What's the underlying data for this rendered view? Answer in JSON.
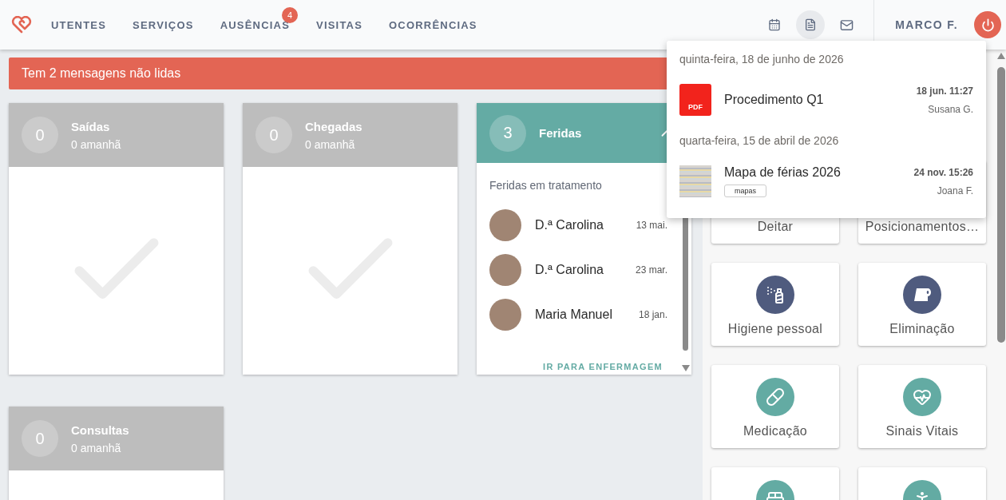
{
  "header": {
    "nav": [
      {
        "label": "UTENTES"
      },
      {
        "label": "SERVIÇOS"
      },
      {
        "label": "AUSÊNCIAS",
        "badge": "4"
      },
      {
        "label": "VISITAS"
      },
      {
        "label": "OCORRÊNCIAS"
      }
    ],
    "tools": [
      {
        "kind": "calendar",
        "selected": false
      },
      {
        "kind": "document",
        "selected": true
      },
      {
        "kind": "mail",
        "selected": false
      }
    ],
    "user": "MARCO F."
  },
  "alert": {
    "text": "Tem 2 mensagens não lidas"
  },
  "summary_cards": [
    {
      "kind": "empty",
      "count": "0",
      "title": "Saídas",
      "subtitle": "0 amanhã"
    },
    {
      "kind": "empty",
      "count": "0",
      "title": "Chegadas",
      "subtitle": "0 amanhã"
    },
    {
      "kind": "list",
      "count": "3",
      "title": "Feridas",
      "heading": "Feridas em tratamento",
      "rows": [
        {
          "name": "D.ª Carolina",
          "date": "13 mai."
        },
        {
          "name": "D.ª Carolina",
          "date": "23 mar."
        },
        {
          "name": "Maria Manuel",
          "date": "18 jan."
        }
      ],
      "link": "IR PARA ENFERMAGEM"
    },
    {
      "kind": "empty",
      "count": "0",
      "title": "Consultas",
      "subtitle": "0 amanhã"
    }
  ],
  "care_tiles": [
    {
      "label": "Deitar"
    },
    {
      "label": "Posicionamentos…"
    },
    {
      "label": "Higiene pessoal",
      "kind": "hygiene",
      "color": "#4f5b7e"
    },
    {
      "label": "Eliminação",
      "kind": "roll",
      "color": "#4f5b7e"
    },
    {
      "label": "Medicação",
      "kind": "pills",
      "color": "#63aba3"
    },
    {
      "label": "Sinais Vitais",
      "kind": "heart",
      "color": "#63aba3"
    },
    {
      "kind": "bed",
      "color": "#63aba3"
    },
    {
      "kind": "person",
      "color": "#63aba3"
    }
  ],
  "documents_menu": {
    "groups": [
      {
        "date": "quinta-feira, 18 de junho de 2026",
        "items": [
          {
            "kind": "pdf",
            "icon_label": "PDF",
            "name": "Procedimento Q1",
            "time": "18 jun. 11:27",
            "author": "Susana G."
          }
        ]
      },
      {
        "date": "quarta-feira, 15 de abril de 2026",
        "items": [
          {
            "kind": "image",
            "name": "Mapa de férias 2026",
            "tag": "mapas",
            "time": "24 nov. 15:26",
            "author": "Joana F."
          }
        ]
      }
    ]
  }
}
